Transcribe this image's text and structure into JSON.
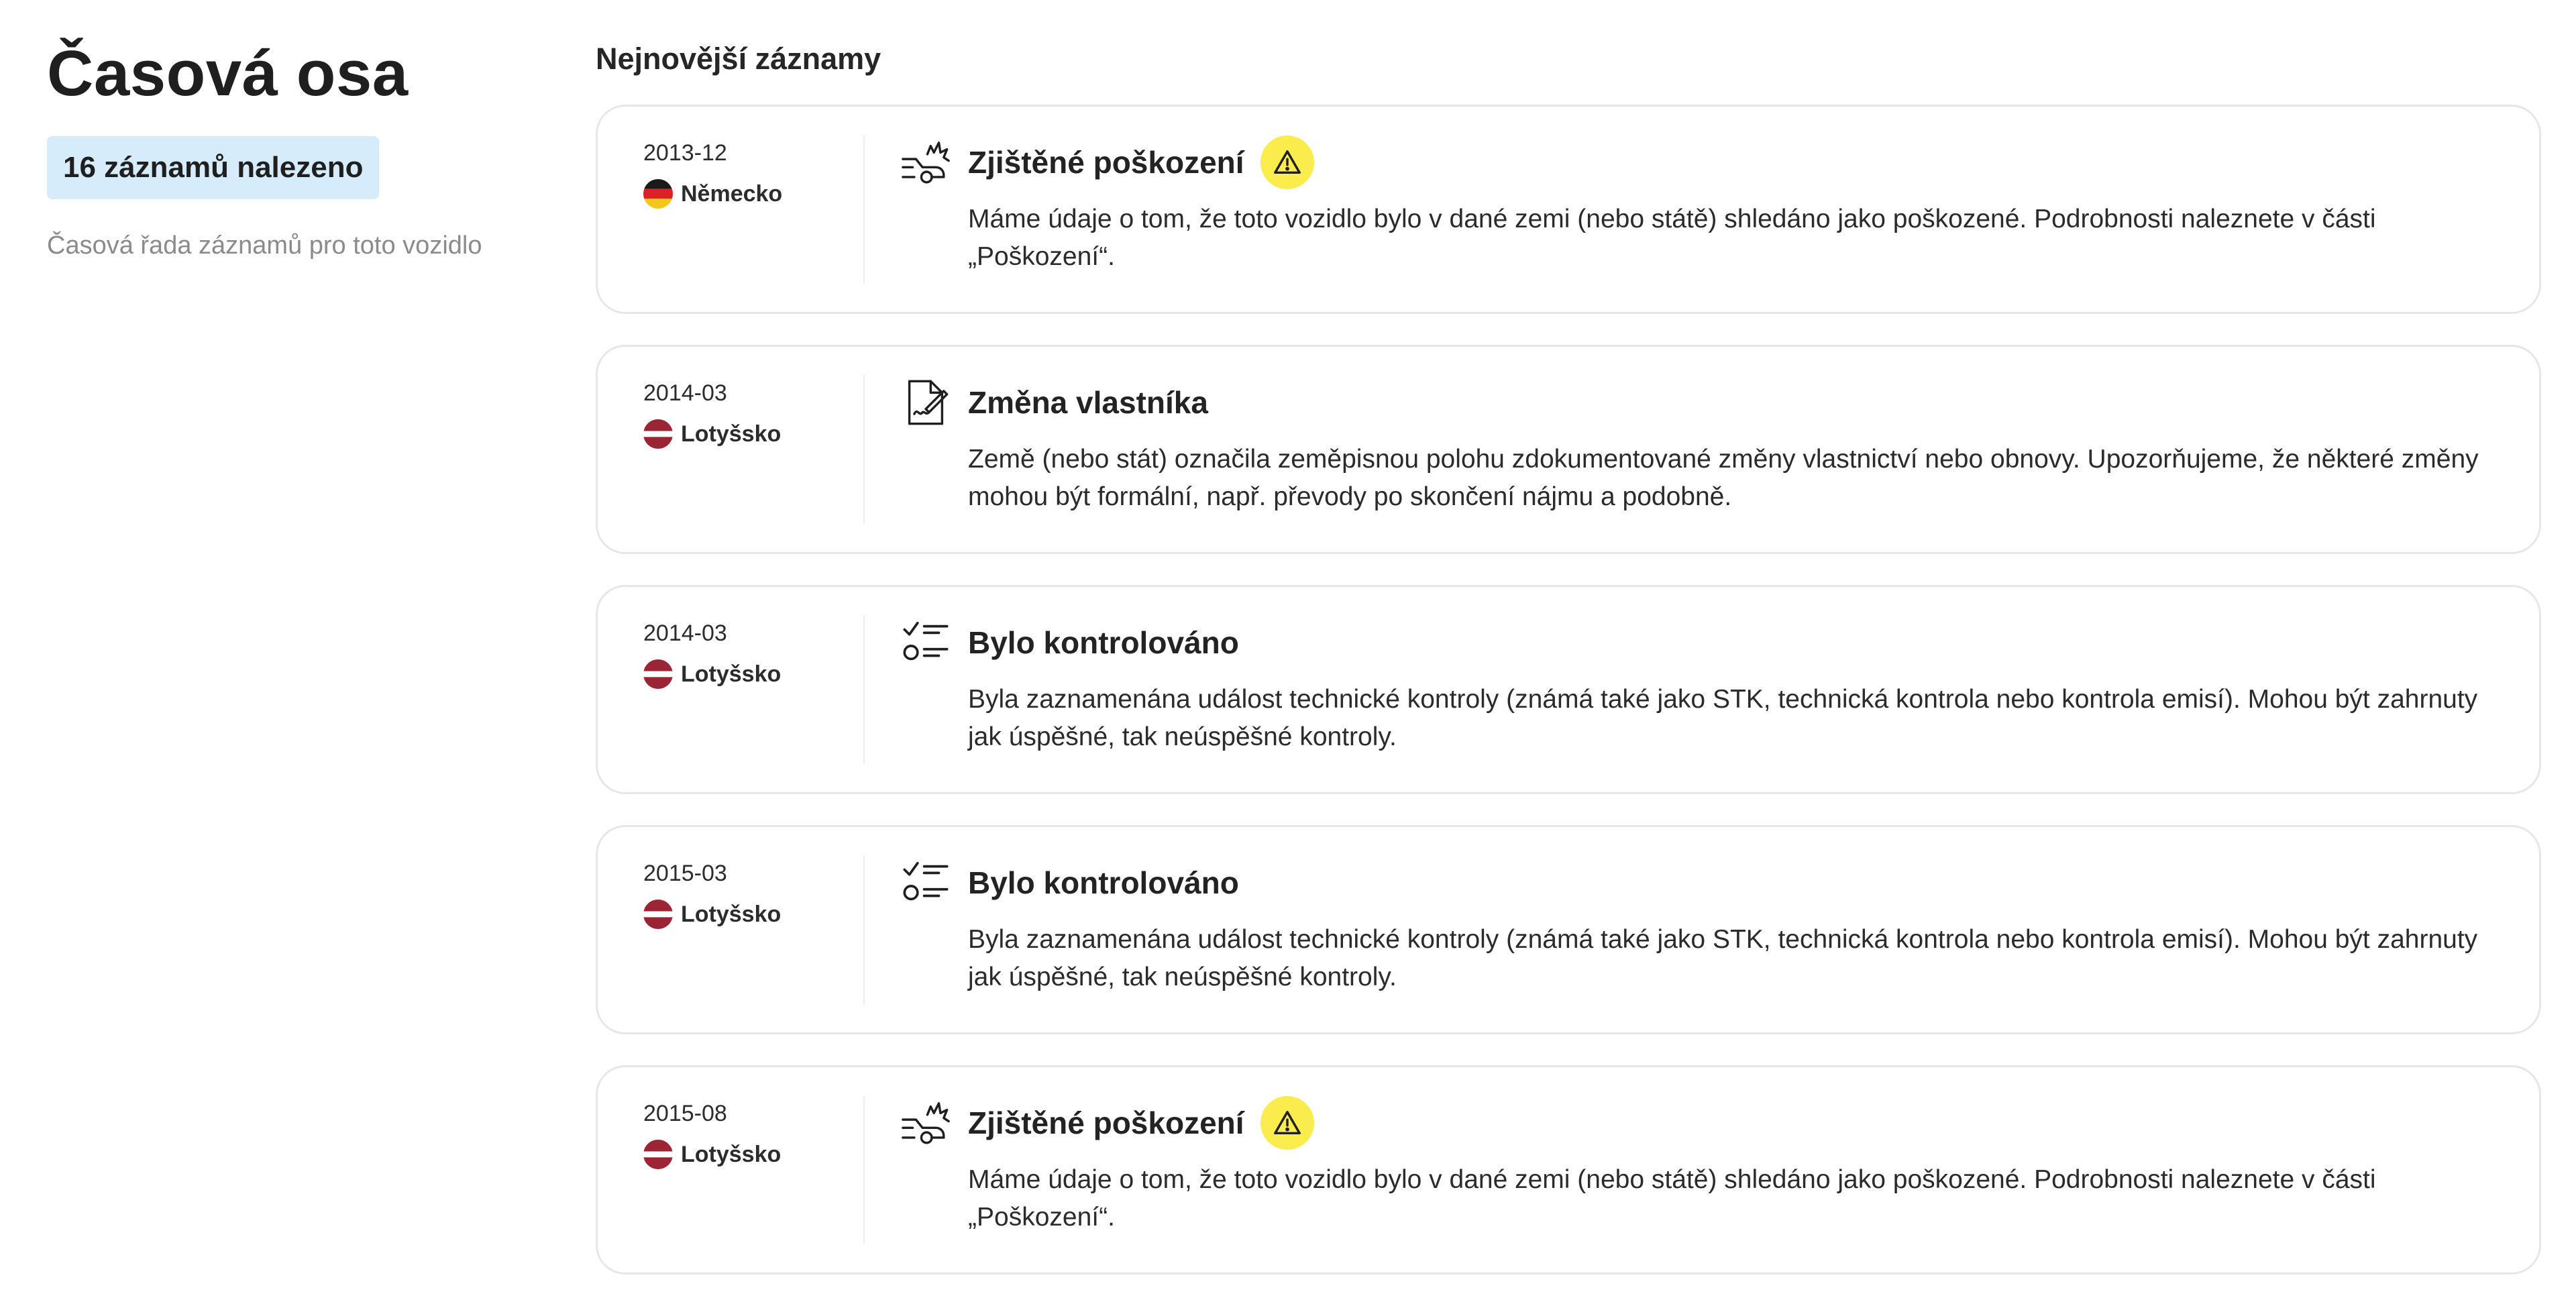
{
  "sidebar": {
    "title": "Časová osa",
    "count_badge": "16 záznamů nalezeno",
    "caption": "Časová řada záznamů pro toto vozidlo"
  },
  "main": {
    "heading": "Nejnovější záznamy",
    "records": [
      {
        "date": "2013-12",
        "country": "Německo",
        "flag": "germany",
        "icon": "damage-icon",
        "title": "Zjištěné poškození",
        "warning": true,
        "description": "Máme údaje o tom, že toto vozidlo bylo v dané zemi (nebo státě) shledáno jako poškozené. Podrobnosti naleznete v části „Poškození“."
      },
      {
        "date": "2014-03",
        "country": "Lotyšsko",
        "flag": "latvia",
        "icon": "document-sign-icon",
        "title": "Změna vlastníka",
        "warning": false,
        "description": "Země (nebo stát) označila zeměpisnou polohu zdokumentované změny vlastnictví nebo obnovy. Upozorňujeme, že některé změny mohou být formální, např. převody po skončení nájmu a podobně."
      },
      {
        "date": "2014-03",
        "country": "Lotyšsko",
        "flag": "latvia",
        "icon": "checklist-icon",
        "title": "Bylo kontrolováno",
        "warning": false,
        "description": "Byla zaznamenána událost technické kontroly (známá také jako STK, technická kontrola nebo kontrola emisí). Mohou být zahrnuty jak úspěšné, tak neúspěšné kontroly."
      },
      {
        "date": "2015-03",
        "country": "Lotyšsko",
        "flag": "latvia",
        "icon": "checklist-icon",
        "title": "Bylo kontrolováno",
        "warning": false,
        "description": "Byla zaznamenána událost technické kontroly (známá také jako STK, technická kontrola nebo kontrola emisí). Mohou být zahrnuty jak úspěšné, tak neúspěšné kontroly."
      },
      {
        "date": "2015-08",
        "country": "Lotyšsko",
        "flag": "latvia",
        "icon": "damage-icon",
        "title": "Zjištěné poškození",
        "warning": true,
        "description": "Máme údaje o tom, že toto vozidlo bylo v dané zemi (nebo státě) shledáno jako poškozené. Podrobnosti naleznete v části „Poškození“."
      }
    ]
  },
  "colors": {
    "badge_bg": "#d7ecfb",
    "warning": "#fbec4e",
    "card_border": "#e7e7e7",
    "muted_text": "#8b8b8b"
  }
}
